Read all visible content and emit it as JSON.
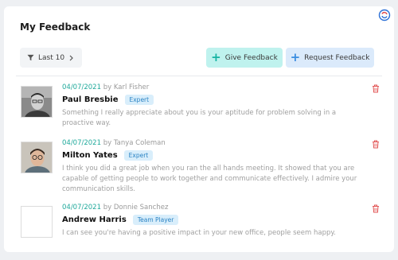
{
  "header": {
    "title": "My Feedback",
    "sync_icon": "sync-icon"
  },
  "toolbar": {
    "filter_label": "Last 10",
    "give_label": "Give Feedback",
    "request_label": "Request Feedback"
  },
  "colors": {
    "accent_teal": "#16b3a3",
    "accent_blue": "#3b8de0",
    "delete_red": "#e25555"
  },
  "feedback": [
    {
      "date": "04/07/2021",
      "by_prefix": "by",
      "author": "Karl Fisher",
      "name": "Paul Bresbie",
      "tag": "Expert",
      "message": "Something I really appreciate about you is your aptitude for problem solving in a proactive way."
    },
    {
      "date": "04/07/2021",
      "by_prefix": "by",
      "author": "Tanya Coleman",
      "name": "Milton Yates",
      "tag": "Expert",
      "message": "I think you did a great job when you ran the all hands meeting. It showed that you are capable of getting people to work together and communicate effectively. I admire your communication skills."
    },
    {
      "date": "04/07/2021",
      "by_prefix": "by",
      "author": "Donnie Sanchez",
      "name": "Andrew Harris",
      "tag": "Team Player",
      "message": "I can see you're having a positive impact in your new office, people seem happy."
    }
  ]
}
